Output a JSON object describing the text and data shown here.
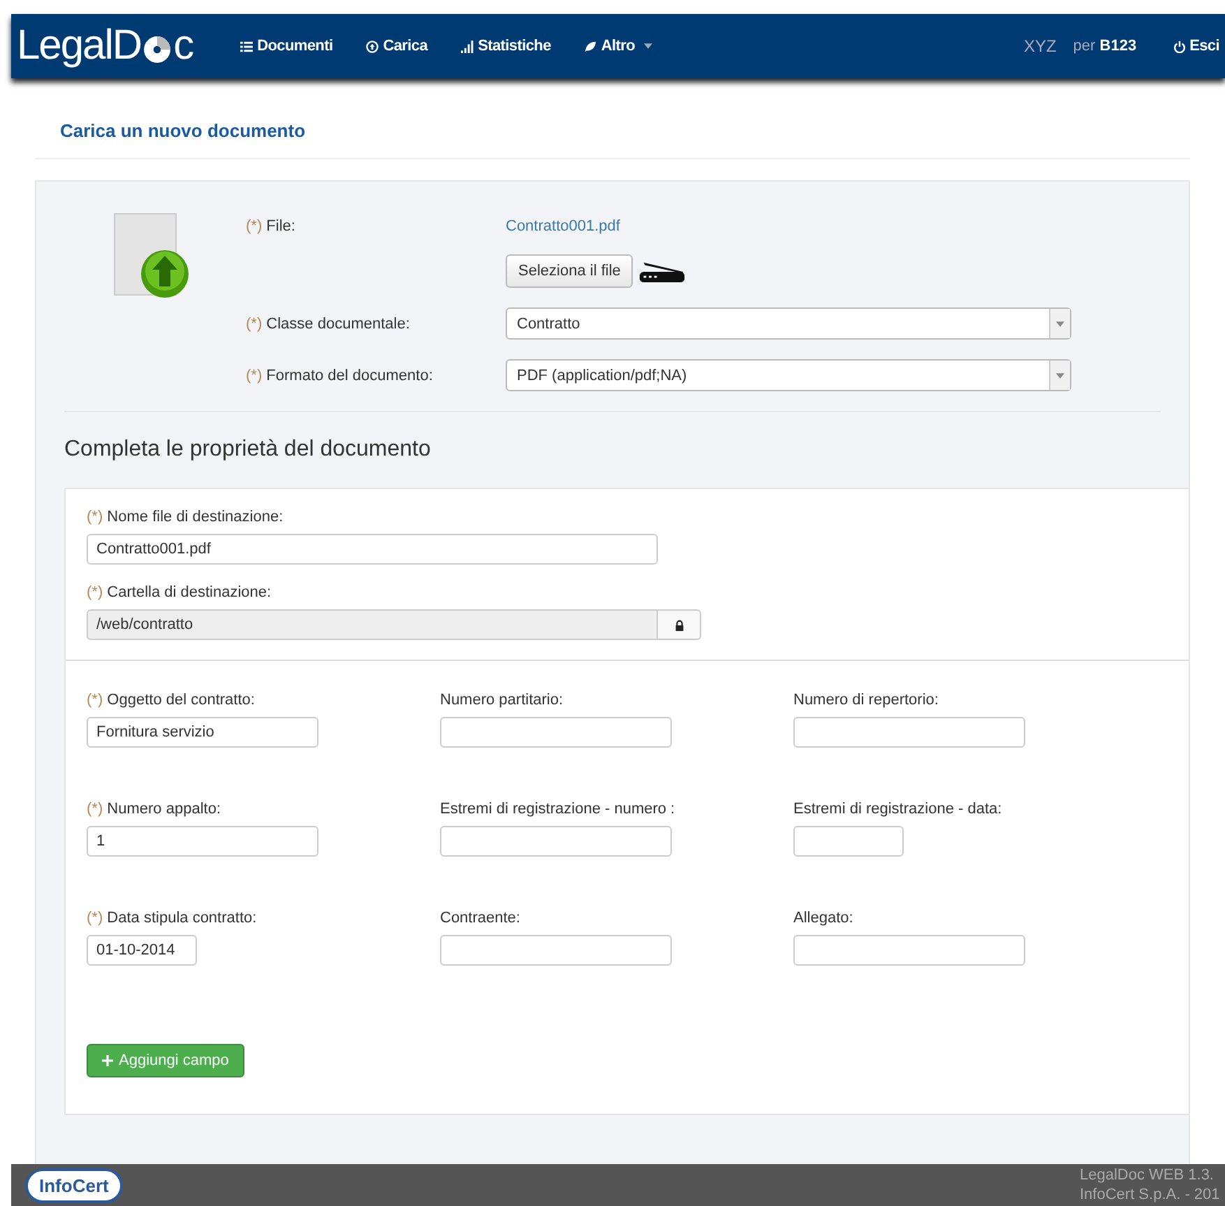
{
  "navbar": {
    "logo": {
      "before": "LegalD",
      "after": "c"
    },
    "items": [
      {
        "label": "Documenti",
        "kind": "list",
        "dropdown": false
      },
      {
        "label": "Carica",
        "kind": "upload",
        "dropdown": false
      },
      {
        "label": "Statistiche",
        "kind": "stats",
        "dropdown": false
      },
      {
        "label": "Altro",
        "kind": "more",
        "dropdown": true
      }
    ],
    "user": {
      "org": "XYZ",
      "per": "per",
      "code": "B123"
    },
    "logout": "Esci"
  },
  "page_title": "Carica un nuovo documento",
  "upload": {
    "rows": [
      {
        "kind": "file",
        "marker": "(*)",
        "label": "File:",
        "value": "Contratto001.pdf",
        "button": "Seleziona il file"
      },
      {
        "kind": "select",
        "marker": "(*)",
        "label": "Classe documentale:",
        "value": "Contratto"
      },
      {
        "kind": "select",
        "marker": "(*)",
        "label": "Formato del documento:",
        "value": "PDF (application/pdf;NA)"
      }
    ]
  },
  "properties": {
    "title": "Completa le proprietà del documento",
    "destination": [
      {
        "marker": "(*)",
        "label": "Nome file di destinazione:",
        "value": "Contratto001.pdf",
        "locked": false
      },
      {
        "marker": "(*)",
        "label": "Cartella di destinazione:",
        "value": "/web/contratto",
        "locked": true
      }
    ],
    "fields": [
      {
        "marker": "(*)",
        "label": "Oggetto del contratto:",
        "value": "Fornitura servizio",
        "kind": "text"
      },
      {
        "label": "Numero partitario:",
        "kind": "text"
      },
      {
        "label": "Numero di repertorio:",
        "kind": "text"
      },
      {
        "marker": "(*)",
        "label": "Numero appalto:",
        "value": "1",
        "kind": "text"
      },
      {
        "label": "Estremi di registrazione - numero :",
        "kind": "text"
      },
      {
        "label": "Estremi di registrazione - data:",
        "kind": "date"
      },
      {
        "marker": "(*)",
        "label": "Data stipula contratto:",
        "value": "01-10-2014",
        "kind": "date"
      },
      {
        "label": "Contraente:",
        "kind": "text"
      },
      {
        "label": "Allegato:",
        "kind": "text"
      }
    ],
    "add_button": "Aggiungi campo"
  },
  "footer": {
    "version": "LegalDoc WEB 1.3.",
    "company": "InfoCert S.p.A. - 201",
    "logo": {
      "before": "Info",
      "after": "Cert"
    }
  }
}
